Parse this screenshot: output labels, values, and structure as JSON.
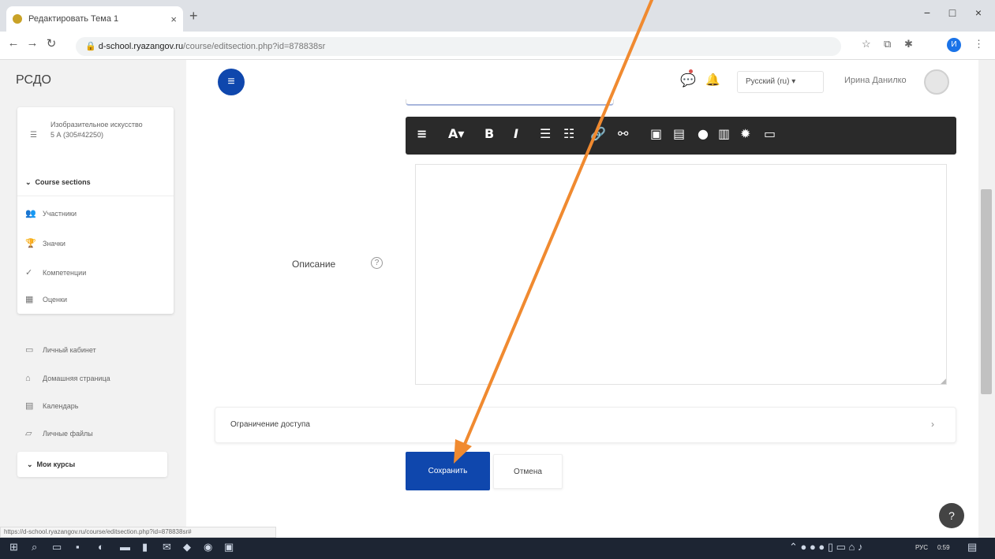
{
  "browser": {
    "tab_title": "Редактировать Тема 1",
    "tab_close": "×",
    "new_tab": "+",
    "url_host": "d-school.ryazangov.ru",
    "url_path": "/course/editsection.php?id=878838sr",
    "status_url": "https://d-school.ryazangov.ru/course/editsection.php?id=878838sr#",
    "window_controls": [
      "−",
      "□",
      "×"
    ],
    "profile_initial": "И"
  },
  "header": {
    "brand": "РСДО",
    "drawer_icon": "≡",
    "language": "Русский (ru) ▾",
    "user_name": "Ирина Данилко"
  },
  "nav": {
    "course_name": "Изобразительное искусство 5 А (305#42250)",
    "course_sections": "Course sections",
    "items": [
      {
        "icon": "participants-icon",
        "label": "Участники"
      },
      {
        "icon": "trophy-icon",
        "label": "Значки"
      },
      {
        "icon": "check-icon",
        "label": "Компетенции"
      },
      {
        "icon": "grades-icon",
        "label": "Оценки"
      }
    ],
    "global_items": [
      {
        "icon": "dashboard-icon",
        "label": "Личный кабинет"
      },
      {
        "icon": "home-icon",
        "label": "Домашняя страница"
      },
      {
        "icon": "calendar-icon",
        "label": "Календарь"
      },
      {
        "icon": "files-icon",
        "label": "Личные файлы"
      }
    ],
    "my_courses": "Мои курсы"
  },
  "form": {
    "description_label": "Описание",
    "help_icon": "?",
    "restrict_access_label": "Ограничение доступа",
    "save_label": "Сохранить",
    "cancel_label": "Отмена"
  },
  "toolbar_icons": [
    "menu-icon",
    "font-color-icon",
    "bold-icon",
    "italic-icon",
    "bullet-list-icon",
    "numbered-list-icon",
    "link-icon",
    "unlink-icon",
    "image-icon",
    "media-icon",
    "microphone-icon",
    "file-icon",
    "settings-icon",
    "screen-icon"
  ],
  "taskbar": {
    "language": "РУС",
    "time": "0:59"
  },
  "colors": {
    "brand_blue": "#0f47ad",
    "toolbar_dark": "#2a2a2a",
    "annotation_arrow": "#f08a30"
  }
}
